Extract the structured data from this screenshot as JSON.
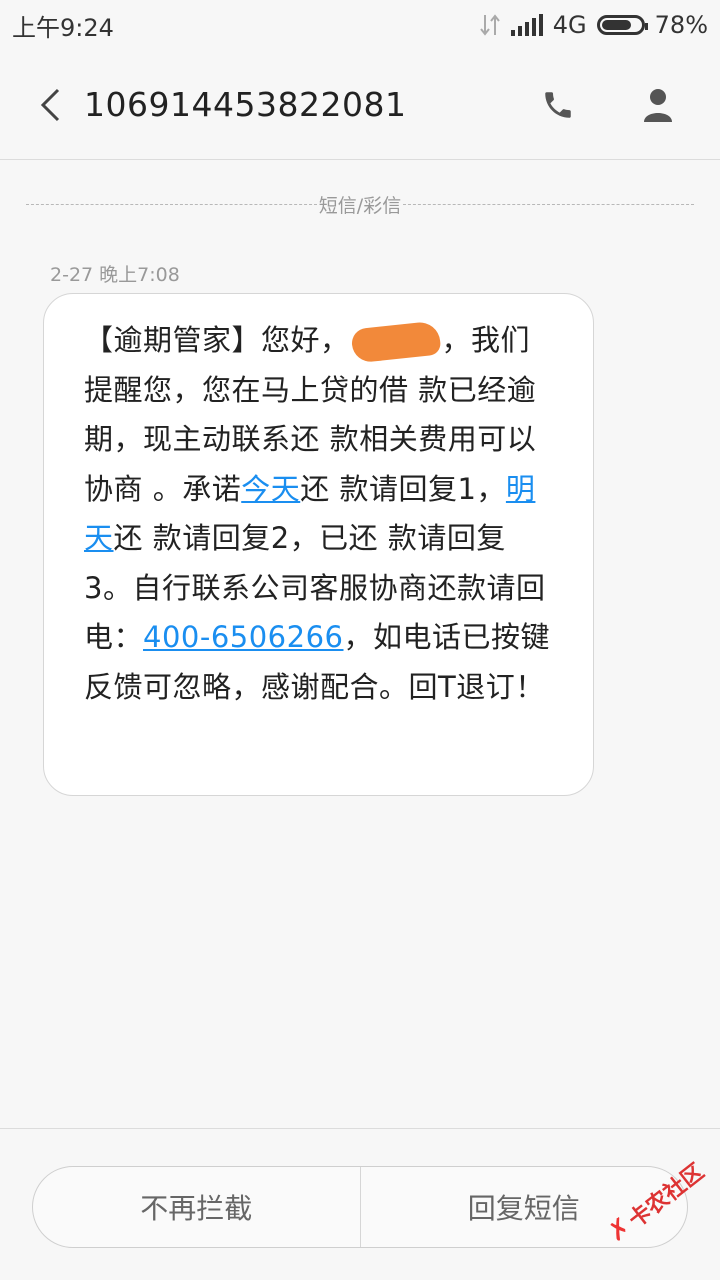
{
  "status_bar": {
    "time": "上午9:24",
    "network": "4G",
    "battery": "78%",
    "battery_level": 0.78
  },
  "header": {
    "contact_number": "106914453822081",
    "icons": [
      "back-icon",
      "phone-icon",
      "person-icon"
    ]
  },
  "conversation": {
    "channel_label": "短信/彩信",
    "messages": [
      {
        "time": "2-27 晚上7:08",
        "segments": {
          "s1": "【逾期管家】您好，",
          "s2": "，我们提醒您，您在马上贷的借 款已经逾 期，现主动联系还 款相关费用可以协商 。承诺",
          "link_today": "今天",
          "s3": "还 款请回复1，",
          "link_tomorrow": "明天",
          "s4": "还 款请回复2，已还 款请回复3。自行联系公司客服协商还款请回电：",
          "link_phone": "400-6506266",
          "s5": "，如电话已按键反馈可忽略，感谢配合。回T退订！"
        }
      }
    ]
  },
  "actions": {
    "unblock": "不再拦截",
    "reply": "回复短信"
  },
  "watermark": {
    "text": "卡农社区"
  },
  "colors": {
    "link": "#1a8ef0",
    "redaction": "#f2893a",
    "background": "#f7f7f7",
    "watermark": "#dd3333"
  }
}
